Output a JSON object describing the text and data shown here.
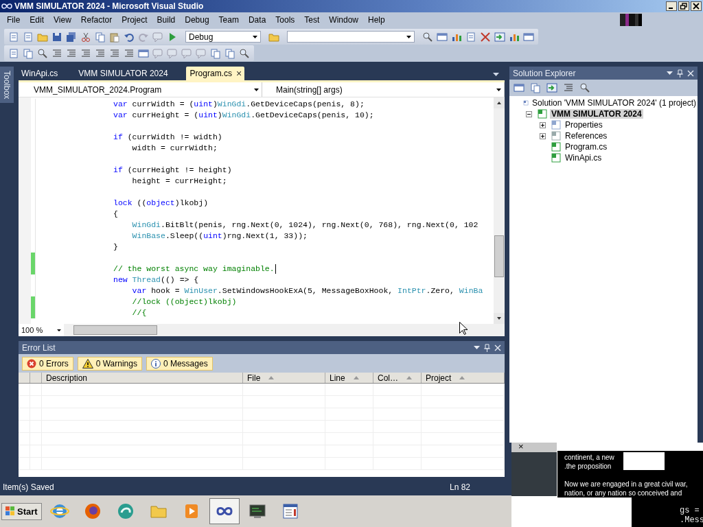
{
  "window": {
    "title": "VMM SIMULATOR 2024 - Microsoft Visual Studio"
  },
  "menu": [
    "File",
    "Edit",
    "View",
    "Refactor",
    "Project",
    "Build",
    "Debug",
    "Team",
    "Data",
    "Tools",
    "Test",
    "Window",
    "Help"
  ],
  "toolbar": {
    "configuration": "Debug"
  },
  "toolbox": {
    "label": "Toolbox"
  },
  "tabs": [
    {
      "label": "WinApi.cs",
      "selected": false
    },
    {
      "label": "VMM SIMULATOR 2024",
      "selected": false
    },
    {
      "label": "Program.cs",
      "selected": true,
      "close": "×"
    }
  ],
  "navigation": {
    "type": "VMM_SIMULATOR_2024.Program",
    "member": "Main(string[] args)"
  },
  "editor": {
    "zoom": "100 %",
    "lines": [
      {
        "changed": false,
        "segments": [
          {
            "kind": "kw",
            "text": "var"
          },
          {
            "kind": "plain",
            "text": " currWidth = ("
          },
          {
            "kind": "kw",
            "text": "uint"
          },
          {
            "kind": "plain",
            "text": ")"
          },
          {
            "kind": "type",
            "text": "WinGdi"
          },
          {
            "kind": "plain",
            "text": ".GetDeviceCaps(penis, 8);"
          }
        ]
      },
      {
        "changed": false,
        "segments": [
          {
            "kind": "kw",
            "text": "var"
          },
          {
            "kind": "plain",
            "text": " currHeight = ("
          },
          {
            "kind": "kw",
            "text": "uint"
          },
          {
            "kind": "plain",
            "text": ")"
          },
          {
            "kind": "type",
            "text": "WinGdi"
          },
          {
            "kind": "plain",
            "text": ".GetDeviceCaps(penis, 10);"
          }
        ]
      },
      {
        "changed": false
      },
      {
        "changed": false,
        "segments": [
          {
            "kind": "kw",
            "text": "if"
          },
          {
            "kind": "plain",
            "text": " (currWidth != width)"
          }
        ]
      },
      {
        "changed": false,
        "segments": [
          {
            "kind": "plain",
            "text": "    width = currWidth;"
          }
        ]
      },
      {
        "changed": false
      },
      {
        "changed": false,
        "segments": [
          {
            "kind": "kw",
            "text": "if"
          },
          {
            "kind": "plain",
            "text": " (currHeight != height)"
          }
        ]
      },
      {
        "changed": false,
        "segments": [
          {
            "kind": "plain",
            "text": "    height = currHeight;"
          }
        ]
      },
      {
        "changed": false
      },
      {
        "changed": false,
        "segments": [
          {
            "kind": "kw",
            "text": "lock"
          },
          {
            "kind": "plain",
            "text": " (("
          },
          {
            "kind": "kw",
            "text": "object"
          },
          {
            "kind": "plain",
            "text": ")lkobj)"
          }
        ]
      },
      {
        "changed": false,
        "segments": [
          {
            "kind": "plain",
            "text": "{"
          }
        ]
      },
      {
        "changed": false,
        "segments": [
          {
            "kind": "type",
            "text": "    WinGdi"
          },
          {
            "kind": "plain",
            "text": ".BitBlt(penis, rng.Next(0, 1024), rng.Next(0, 768), rng.Next(0, 102"
          }
        ]
      },
      {
        "changed": false,
        "segments": [
          {
            "kind": "type",
            "text": "    WinBase"
          },
          {
            "kind": "plain",
            "text": ".Sleep(("
          },
          {
            "kind": "kw",
            "text": "uint"
          },
          {
            "kind": "plain",
            "text": ")rng.Next(1, 33));"
          }
        ]
      },
      {
        "changed": false,
        "segments": [
          {
            "kind": "plain",
            "text": "}"
          }
        ]
      },
      {
        "changed": true
      },
      {
        "changed": true,
        "caret": true,
        "segments": [
          {
            "kind": "comment",
            "text": "// the worst async way imaginable."
          }
        ]
      },
      {
        "changed": false,
        "segments": [
          {
            "kind": "kw",
            "text": "new "
          },
          {
            "kind": "type",
            "text": "Thread"
          },
          {
            "kind": "plain",
            "text": "(() => {"
          }
        ]
      },
      {
        "changed": false,
        "segments": [
          {
            "kind": "kw",
            "text": "    var"
          },
          {
            "kind": "plain",
            "text": " hook = "
          },
          {
            "kind": "type",
            "text": "WinUser"
          },
          {
            "kind": "plain",
            "text": ".SetWindowsHookExA(5, MessageBoxHook, "
          },
          {
            "kind": "type",
            "text": "IntPtr"
          },
          {
            "kind": "plain",
            "text": ".Zero, "
          },
          {
            "kind": "type",
            "text": "WinBa"
          }
        ]
      },
      {
        "changed": true,
        "segments": [
          {
            "kind": "comment",
            "text": "    //lock ((object)lkobj)"
          }
        ]
      },
      {
        "changed": true,
        "segments": [
          {
            "kind": "comment",
            "text": "    //{"
          }
        ]
      }
    ]
  },
  "error_list": {
    "title": "Error List",
    "filters": [
      {
        "kind": "error",
        "label": "0 Errors",
        "selected": true
      },
      {
        "kind": "warning",
        "label": "0 Warnings",
        "selected": true
      },
      {
        "kind": "info",
        "label": "0 Messages",
        "selected": true
      }
    ],
    "columns": [
      {
        "label": "Description",
        "sort_arrow": false
      },
      {
        "label": "File",
        "sort_arrow": true
      },
      {
        "label": "Line",
        "sort_arrow": true
      },
      {
        "label": "Col…",
        "sort_arrow": true
      },
      {
        "label": "Project",
        "sort_arrow": true
      }
    ]
  },
  "solution_explorer": {
    "title": "Solution Explorer",
    "tree": [
      {
        "kind": "solution",
        "label": "Solution 'VMM SIMULATOR 2024' (1 project)",
        "selected": false,
        "children": [
          {
            "kind": "project",
            "label": "VMM SIMULATOR 2024",
            "selected": true,
            "expanded": true,
            "children": [
              {
                "kind": "properties",
                "label": "Properties",
                "selected": false,
                "expanded": false
              },
              {
                "kind": "references",
                "label": "References",
                "selected": false,
                "expanded": false
              },
              {
                "kind": "file",
                "label": "Program.cs",
                "selected": false
              },
              {
                "kind": "file",
                "label": "WinApi.cs",
                "selected": false
              }
            ]
          }
        ]
      }
    ]
  },
  "status_bar": {
    "message": "Item(s) Saved",
    "line": "Ln 82"
  },
  "taskbar": {
    "start": "Start",
    "buttons": [
      {
        "kind": "ie",
        "selected": false
      },
      {
        "kind": "firefox",
        "selected": false
      },
      {
        "kind": "swirl",
        "selected": false
      },
      {
        "kind": "folder",
        "selected": false
      },
      {
        "kind": "media",
        "selected": false
      },
      {
        "kind": "vs",
        "selected": true
      },
      {
        "kind": "terminal",
        "selected": false
      },
      {
        "kind": "document",
        "selected": false
      }
    ]
  },
  "overlay": {
    "close": "×",
    "lines": [
      "continent, a new",
      ".the proposition",
      "Now we are engaged in a great civil war,",
      "nation, or any nation so conceived and"
    ],
    "console": [
      "gs =",
      ".Mess"
    ]
  }
}
